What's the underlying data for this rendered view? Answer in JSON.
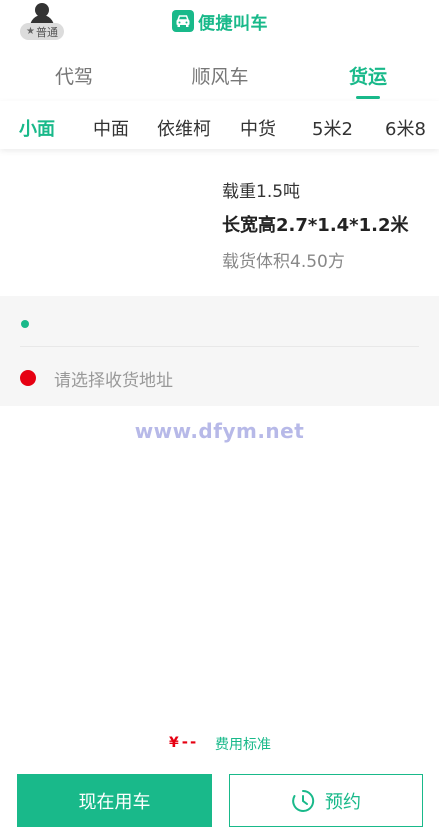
{
  "header": {
    "member_badge": "普通",
    "brand_title": "便捷叫车"
  },
  "service_tabs": [
    {
      "label": "代驾",
      "active": false
    },
    {
      "label": "顺风车",
      "active": false
    },
    {
      "label": "货运",
      "active": true
    }
  ],
  "vehicle_tabs": [
    {
      "label": "小面",
      "active": true
    },
    {
      "label": "中面",
      "active": false
    },
    {
      "label": "依维柯",
      "active": false
    },
    {
      "label": "中货",
      "active": false
    },
    {
      "label": "5米2",
      "active": false
    },
    {
      "label": "6米8",
      "active": false
    }
  ],
  "vehicle_spec": {
    "load_weight": "载重1.5吨",
    "dimensions": "长宽高2.7*1.4*1.2米",
    "cargo_volume": "载货体积4.50方"
  },
  "address": {
    "dropoff_placeholder": "请选择收货地址"
  },
  "watermark": "www.dfym.net",
  "pricing": {
    "currency_symbol": "¥",
    "value": "--",
    "fee_standard_link": "费用标准"
  },
  "actions": {
    "now_label": "现在用车",
    "reserve_label": "预约"
  },
  "colors": {
    "accent": "#19b98a",
    "price": "#e60012"
  }
}
